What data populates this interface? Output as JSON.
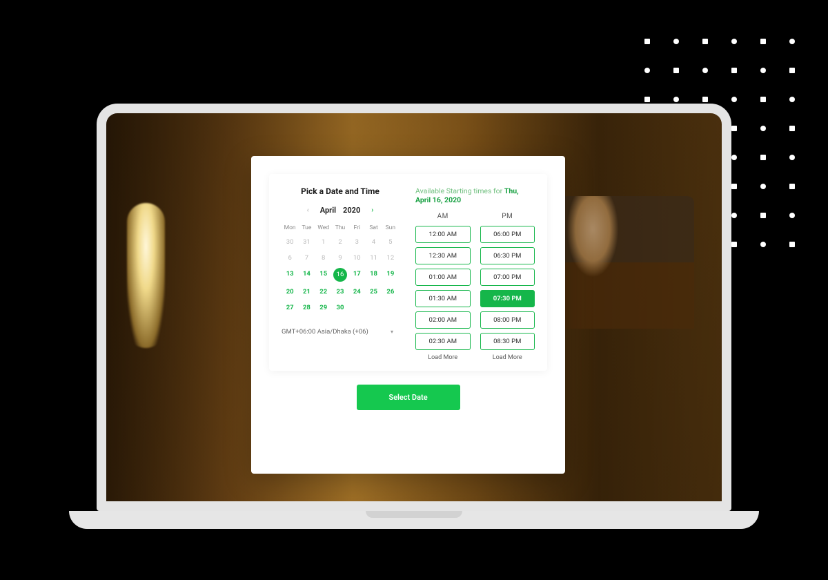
{
  "colors": {
    "accent": "#15b64a",
    "accent_bright": "#15c84f"
  },
  "card": {
    "title": "Pick a Date and Time",
    "available_prefix": "Available Starting times for ",
    "available_date": "Thu, April 16, 2020",
    "select_button": "Select Date"
  },
  "calendar": {
    "month": "April",
    "year": "2020",
    "dow": [
      "Mon",
      "Tue",
      "Wed",
      "Thu",
      "Fri",
      "Sat",
      "Sun"
    ],
    "weeks": [
      [
        {
          "n": "30",
          "a": false
        },
        {
          "n": "31",
          "a": false
        },
        {
          "n": "1",
          "a": false
        },
        {
          "n": "2",
          "a": false
        },
        {
          "n": "3",
          "a": false
        },
        {
          "n": "4",
          "a": false
        },
        {
          "n": "5",
          "a": false
        }
      ],
      [
        {
          "n": "6",
          "a": false
        },
        {
          "n": "7",
          "a": false
        },
        {
          "n": "8",
          "a": false
        },
        {
          "n": "9",
          "a": false
        },
        {
          "n": "10",
          "a": false
        },
        {
          "n": "11",
          "a": false
        },
        {
          "n": "12",
          "a": false
        }
      ],
      [
        {
          "n": "13",
          "a": true
        },
        {
          "n": "14",
          "a": true
        },
        {
          "n": "15",
          "a": true
        },
        {
          "n": "16",
          "a": true,
          "sel": true
        },
        {
          "n": "17",
          "a": true
        },
        {
          "n": "18",
          "a": true
        },
        {
          "n": "19",
          "a": true
        }
      ],
      [
        {
          "n": "20",
          "a": true
        },
        {
          "n": "21",
          "a": true
        },
        {
          "n": "22",
          "a": true
        },
        {
          "n": "23",
          "a": true
        },
        {
          "n": "24",
          "a": true
        },
        {
          "n": "25",
          "a": true
        },
        {
          "n": "26",
          "a": true
        }
      ],
      [
        {
          "n": "27",
          "a": true
        },
        {
          "n": "28",
          "a": true
        },
        {
          "n": "29",
          "a": true
        },
        {
          "n": "30",
          "a": true
        },
        {
          "n": "",
          "a": false
        },
        {
          "n": "",
          "a": false
        },
        {
          "n": "",
          "a": false
        }
      ]
    ],
    "timezone": "GMT+06:00 Asia/Dhaka (+06)"
  },
  "slots": {
    "am_label": "AM",
    "pm_label": "PM",
    "am": [
      "12:00 AM",
      "12:30 AM",
      "01:00 AM",
      "01:30 AM",
      "02:00 AM",
      "02:30 AM"
    ],
    "pm": [
      "06:00 PM",
      "06:30 PM",
      "07:00 PM",
      "07:30 PM",
      "08:00 PM",
      "08:30 PM"
    ],
    "selected_pm_index": 3,
    "load_more": "Load More"
  }
}
